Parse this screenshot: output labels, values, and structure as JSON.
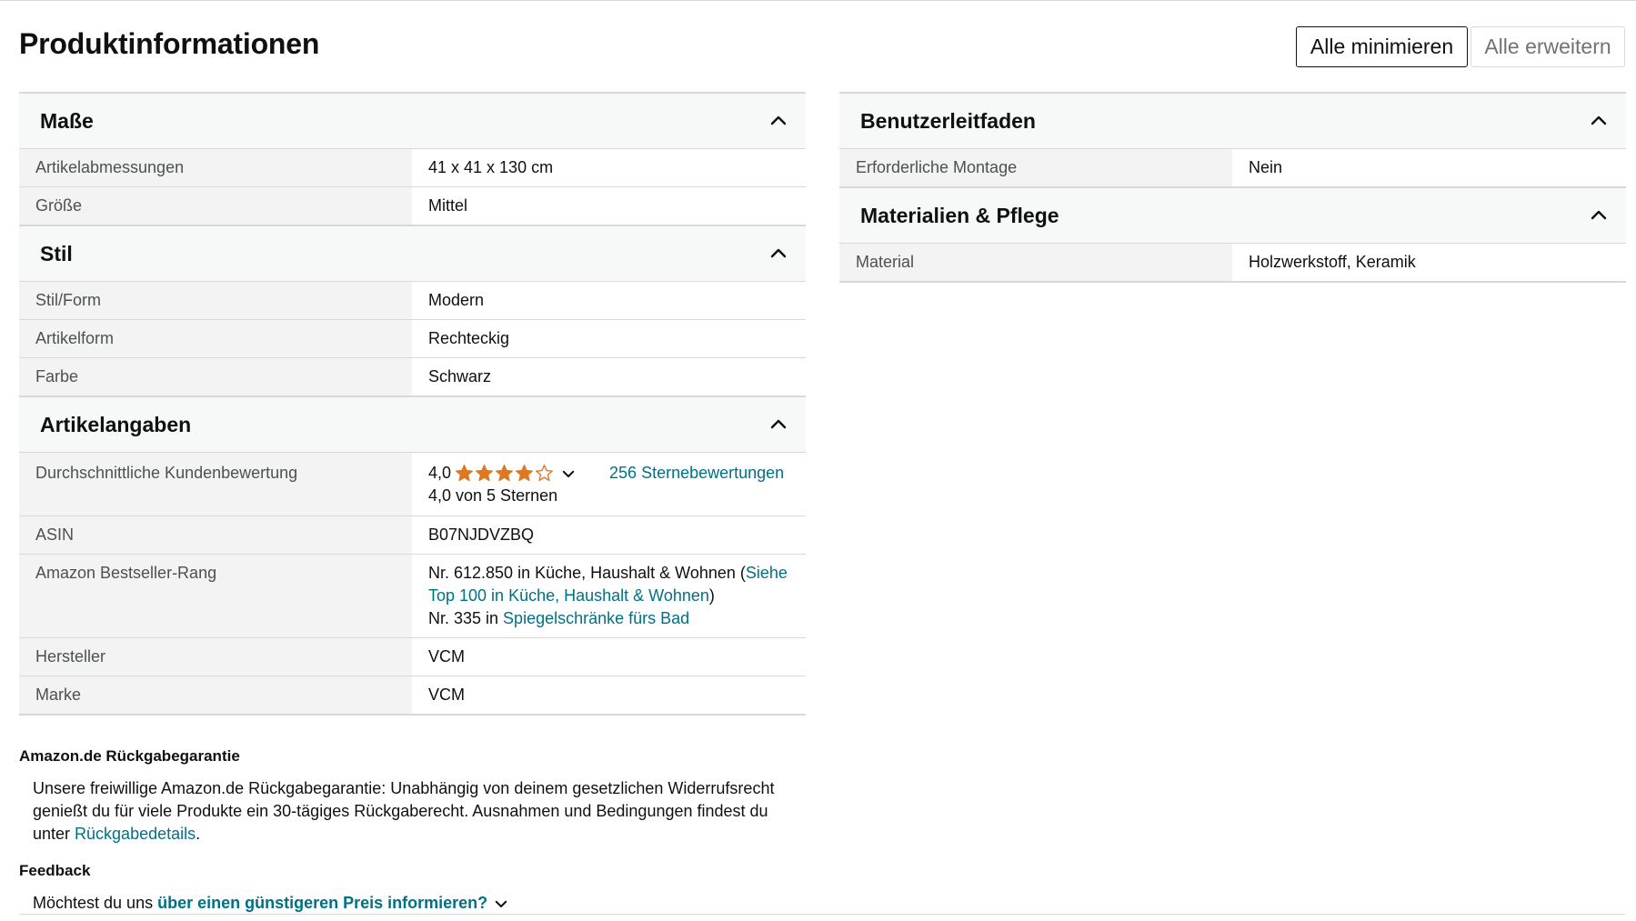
{
  "page": {
    "title": "Produktinformationen"
  },
  "controls": {
    "collapse_all": "Alle minimieren",
    "expand_all": "Alle erweitern"
  },
  "sections": {
    "masse": {
      "title": "Maße",
      "rows": [
        {
          "key": "Artikelabmessungen",
          "value": "41 x 41 x 130 cm"
        },
        {
          "key": "Größe",
          "value": "Mittel"
        }
      ]
    },
    "stil": {
      "title": "Stil",
      "rows": [
        {
          "key": "Stil/Form",
          "value": "Modern"
        },
        {
          "key": "Artikelform",
          "value": "Rechteckig"
        },
        {
          "key": "Farbe",
          "value": "Schwarz"
        }
      ]
    },
    "artikelangaben": {
      "title": "Artikelangaben",
      "rating": {
        "key": "Durchschnittliche Kundenbewertung",
        "value": "4,0",
        "stars": 4,
        "star_count_link": "256 Sternebewertungen",
        "subtext": "4,0 von 5 Sternen"
      },
      "asin": {
        "key": "ASIN",
        "value": "B07NJDVZBQ"
      },
      "bestseller": {
        "key": "Amazon Bestseller-Rang",
        "line1_prefix": "Nr. 612.850 in Küche, Haushalt & Wohnen (",
        "line1_link": "Siehe Top 100 in Küche, Haushalt & Wohnen",
        "line1_suffix": ")",
        "line2_prefix": "Nr. 335 in ",
        "line2_link": "Spiegelschränke fürs Bad"
      },
      "hersteller": {
        "key": "Hersteller",
        "value": "VCM"
      },
      "marke": {
        "key": "Marke",
        "value": "VCM"
      }
    },
    "benutzerleitfaden": {
      "title": "Benutzerleitfaden",
      "rows": [
        {
          "key": "Erforderliche Montage",
          "value": "Nein"
        }
      ]
    },
    "materialien": {
      "title": "Materialien & Pflege",
      "rows": [
        {
          "key": "Material",
          "value": "Holzwerkstoff, Keramik"
        }
      ]
    }
  },
  "return_policy": {
    "title": "Amazon.de Rückgabegarantie",
    "text": "Unsere freiwillige Amazon.de Rückgabegarantie:  Unabhängig von deinem gesetzlichen Widerrufsrecht genießt du für viele Produkte ein 30-tägiges Rückgaberecht. Ausnahmen und Bedingungen findest du unter ",
    "link": "Rückgabedetails",
    "end": "."
  },
  "feedback": {
    "title": "Feedback",
    "prefix": "Möchtest du uns ",
    "link": "über einen günstigeren Preis informieren?"
  },
  "icons": {
    "collapse": "chevron-up-icon",
    "star": "star-icon",
    "dropdown": "chevron-down-icon"
  },
  "colors": {
    "link": "#007185",
    "star": "#de7921",
    "border": "#d5d9d9",
    "key_bg": "#f3f3f3"
  }
}
